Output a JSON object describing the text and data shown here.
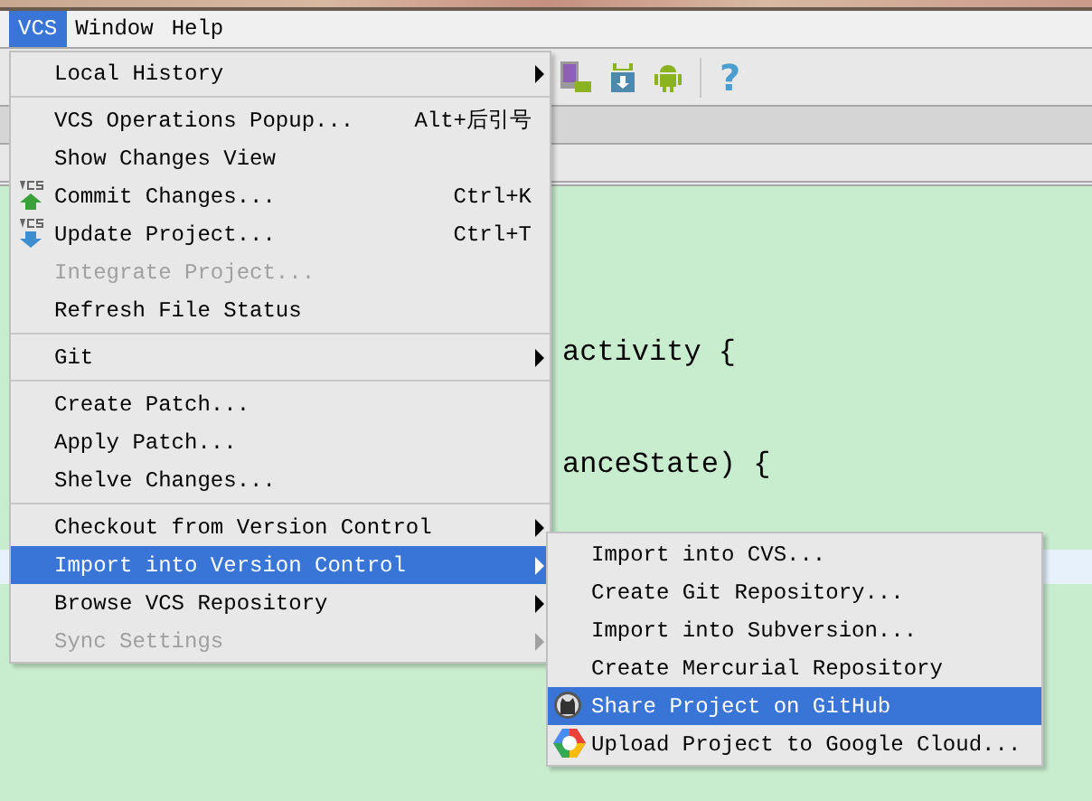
{
  "menu_bar": [
    {
      "label": "VCS",
      "selected": true
    },
    {
      "label": "Window",
      "selected": false
    },
    {
      "label": "Help",
      "selected": false
    }
  ],
  "toolbar": {
    "help_button": "?"
  },
  "editor": {
    "lines": [
      "activity {",
      "anceState) {"
    ]
  },
  "vcs_menu": {
    "items": [
      {
        "kind": "item",
        "label": "Local History",
        "submenu": true,
        "disabled": false,
        "selected": false
      },
      {
        "kind": "separator"
      },
      {
        "kind": "item",
        "label": "VCS Operations Popup...",
        "shortcut": "Alt+后引号",
        "submenu": false,
        "disabled": false,
        "selected": false
      },
      {
        "kind": "item",
        "label": "Show Changes View",
        "submenu": false,
        "disabled": false,
        "selected": false
      },
      {
        "kind": "commit",
        "label": "Commit Changes...",
        "shortcut": "Ctrl+K",
        "submenu": false,
        "disabled": false,
        "selected": false
      },
      {
        "kind": "update",
        "label": "Update Project...",
        "shortcut": "Ctrl+T",
        "submenu": false,
        "disabled": false,
        "selected": false
      },
      {
        "kind": "item",
        "label": "Integrate Project...",
        "submenu": false,
        "disabled": true,
        "selected": false
      },
      {
        "kind": "item",
        "label": "Refresh File Status",
        "submenu": false,
        "disabled": false,
        "selected": false
      },
      {
        "kind": "separator"
      },
      {
        "kind": "item",
        "label": "Git",
        "submenu": true,
        "disabled": false,
        "selected": false
      },
      {
        "kind": "separator"
      },
      {
        "kind": "item",
        "label": "Create Patch...",
        "submenu": false,
        "disabled": false,
        "selected": false
      },
      {
        "kind": "item",
        "label": "Apply Patch...",
        "submenu": false,
        "disabled": false,
        "selected": false
      },
      {
        "kind": "item",
        "label": "Shelve Changes...",
        "submenu": false,
        "disabled": false,
        "selected": false
      },
      {
        "kind": "separator"
      },
      {
        "kind": "item",
        "label": "Checkout from Version Control",
        "submenu": true,
        "disabled": false,
        "selected": false
      },
      {
        "kind": "item",
        "label": "Import into Version Control",
        "submenu": true,
        "disabled": false,
        "selected": true
      },
      {
        "kind": "item",
        "label": "Browse VCS Repository",
        "submenu": true,
        "disabled": false,
        "selected": false
      },
      {
        "kind": "item",
        "label": "Sync Settings",
        "submenu": true,
        "disabled": true,
        "selected": false
      }
    ]
  },
  "import_submenu": {
    "items": [
      {
        "kind": "item",
        "label": "Import into CVS...",
        "selected": false
      },
      {
        "kind": "item",
        "label": "Create Git Repository...",
        "selected": false
      },
      {
        "kind": "item",
        "label": "Import into Subversion...",
        "selected": false
      },
      {
        "kind": "item",
        "label": "Create Mercurial Repository",
        "selected": false
      },
      {
        "kind": "github",
        "label": "Share Project on GitHub",
        "selected": true
      },
      {
        "kind": "cloud",
        "label": "Upload Project to Google Cloud...",
        "selected": false
      }
    ]
  }
}
